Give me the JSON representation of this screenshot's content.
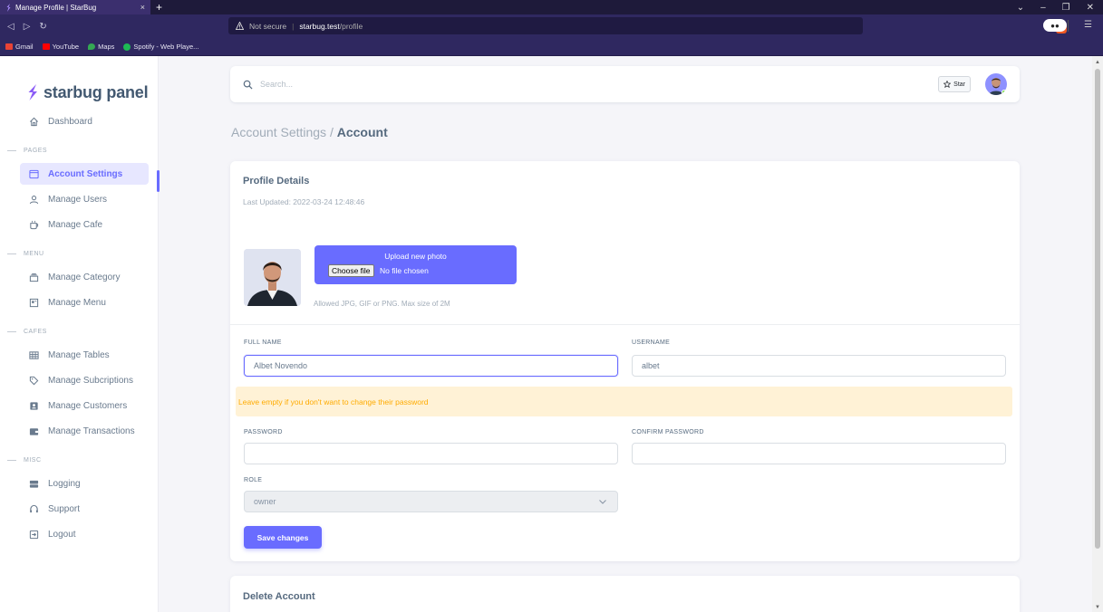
{
  "browser": {
    "tab_title": "Manage Profile | StarBug",
    "tab_close": "×",
    "new_tab": "+",
    "security": "Not secure",
    "url_host": "starbug.test",
    "url_path": "/profile",
    "bookmarks": [
      {
        "label": "Gmail",
        "color": "#ea4335"
      },
      {
        "label": "YouTube",
        "color": "#ff0000"
      },
      {
        "label": "Maps",
        "color": "#34a853"
      },
      {
        "label": "Spotify - Web Playe...",
        "color": "#1db954"
      }
    ]
  },
  "sidebar": {
    "brand": "starbug panel",
    "dashboard": "Dashboard",
    "sections": {
      "pages": "PAGES",
      "menu": "MENU",
      "cafes": "CAFES",
      "misc": "MISC"
    },
    "items": {
      "account_settings": "Account Settings",
      "manage_users": "Manage Users",
      "manage_cafe": "Manage Cafe",
      "manage_category": "Manage Category",
      "manage_menu": "Manage Menu",
      "manage_tables": "Manage Tables",
      "manage_subscriptions": "Manage Subcriptions",
      "manage_customers": "Manage Customers",
      "manage_transactions": "Manage Transactions",
      "logging": "Logging",
      "support": "Support",
      "logout": "Logout"
    }
  },
  "topbar": {
    "search_placeholder": "Search...",
    "star_label": "Star"
  },
  "breadcrumb": {
    "parent": "Account Settings /",
    "current": "Account"
  },
  "profile": {
    "title": "Profile Details",
    "last_updated": "Last Updated: 2022-03-24 12:48:46",
    "upload_label": "Upload new photo",
    "choose_file": "Choose file",
    "no_file": "No file chosen",
    "allowed": "Allowed JPG, GIF or PNG. Max size of 2M",
    "full_name_label": "FULL NAME",
    "full_name_value": "Albet Novendo",
    "username_label": "USERNAME",
    "username_value": "albet",
    "password_notice": "Leave empty if you don't want to change their password",
    "password_label": "PASSWORD",
    "confirm_label": "CONFIRM PASSWORD",
    "role_label": "ROLE",
    "role_value": "owner",
    "save_label": "Save changes"
  },
  "delete_account": {
    "title": "Delete Account"
  },
  "colors": {
    "primary": "#696cff",
    "warning": "#ffab00",
    "success": "#71dd37"
  }
}
